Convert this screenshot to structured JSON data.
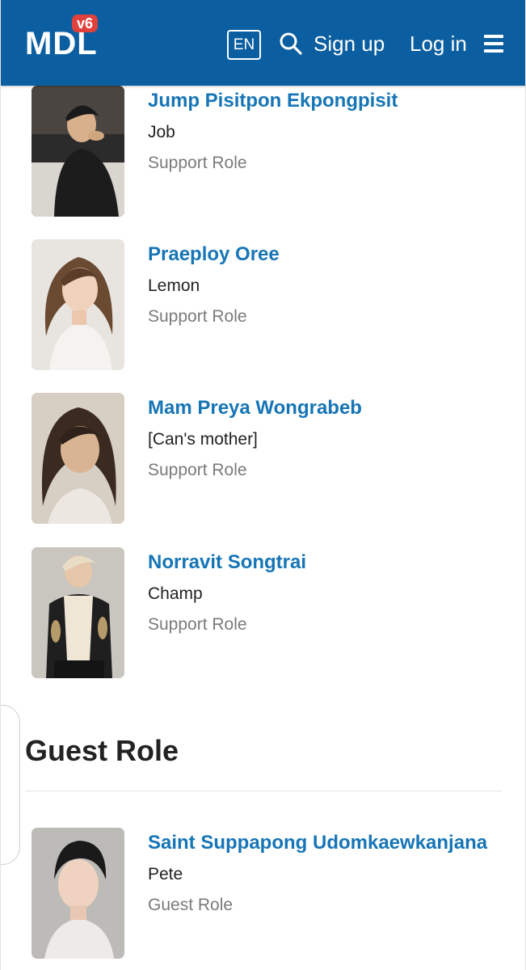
{
  "header": {
    "logo_text": "MDL",
    "logo_badge": "v6",
    "lang_button": "EN",
    "signup_label": "Sign up",
    "login_label": "Log in",
    "icons": {
      "search": "search-icon",
      "menu": "hamburger-menu-icon"
    },
    "colors": {
      "bar": "#0b5fa0",
      "badge": "#e0413d"
    }
  },
  "support_cast": [
    {
      "name": "Jump Pisitpon Ekpongpisit",
      "character": "Job",
      "role": "Support Role"
    },
    {
      "name": "Praeploy Oree",
      "character": "Lemon",
      "role": "Support Role"
    },
    {
      "name": "Mam Preya Wongrabeb",
      "character": "[Can's mother]",
      "role": "Support Role"
    },
    {
      "name": "Norravit Songtrai",
      "character": "Champ",
      "role": "Support Role"
    }
  ],
  "guest_section": {
    "title": "Guest Role",
    "cast": [
      {
        "name": "Saint Suppapong Udomkaewkanjana",
        "character": "Pete",
        "role": "Guest Role"
      }
    ]
  },
  "colors": {
    "name_link": "#1675b6",
    "role_text": "#7a7a7a"
  }
}
